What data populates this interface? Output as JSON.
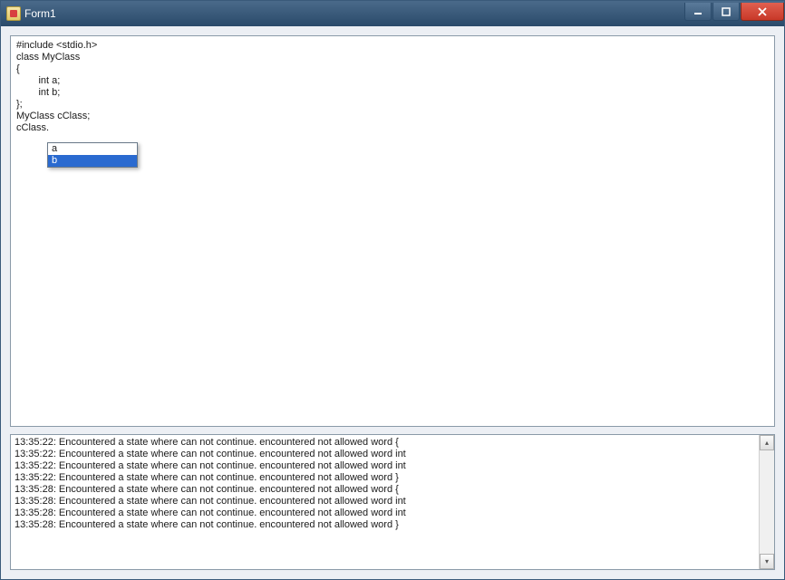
{
  "window": {
    "title": "Form1"
  },
  "editor": {
    "lines": [
      "#include <stdio.h>",
      "",
      "class MyClass",
      "{",
      "        int a;",
      "        int b;",
      "};",
      "",
      "MyClass cClass;",
      "cClass."
    ]
  },
  "autocomplete": {
    "items": [
      "a",
      "b"
    ],
    "selected_index": 1
  },
  "log": {
    "entries": [
      "13:35:22: Encountered a state where can not continue. encountered not allowed word {",
      "13:35:22: Encountered a state where can not continue. encountered not allowed word int",
      "13:35:22: Encountered a state where can not continue. encountered not allowed word int",
      "13:35:22: Encountered a state where can not continue. encountered not allowed word }",
      "13:35:28: Encountered a state where can not continue. encountered not allowed word {",
      "13:35:28: Encountered a state where can not continue. encountered not allowed word int",
      "13:35:28: Encountered a state where can not continue. encountered not allowed word int",
      "13:35:28: Encountered a state where can not continue. encountered not allowed word }"
    ]
  }
}
